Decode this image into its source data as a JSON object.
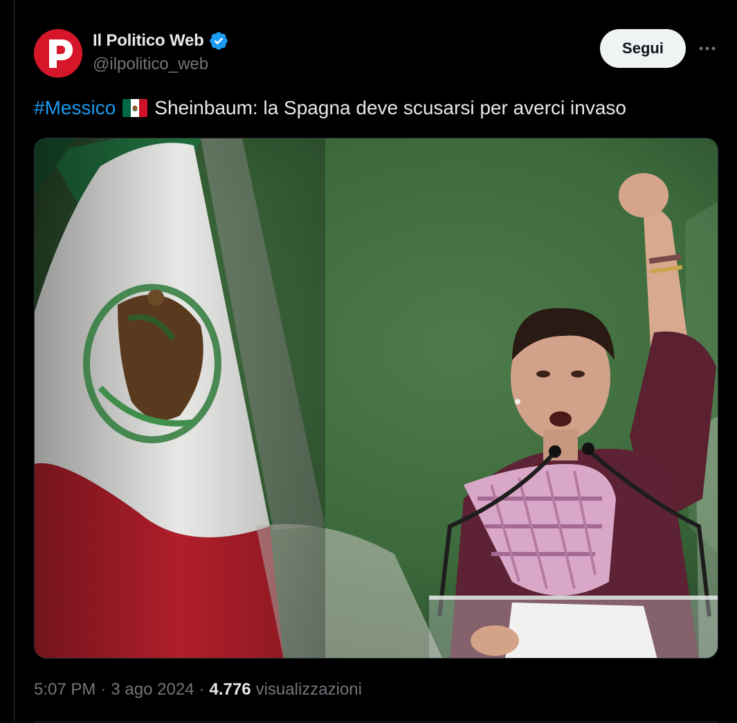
{
  "author": {
    "display_name": "Il Politico Web",
    "handle": "@ilpolitico_web",
    "avatar_letter": "P",
    "avatar_color": "#d6172a",
    "verified": true,
    "verified_icon": "verified-badge-icon",
    "verified_color": "#1d9bf0"
  },
  "actions": {
    "follow_label": "Segui",
    "more_icon": "more-horizontal-icon"
  },
  "tweet": {
    "hashtag": "#Messico",
    "flag_icon": "mexico-flag-icon",
    "text": "Sheinbaum: la Spagna deve scusarsi per averci invaso",
    "media_icon": "photo-woman-speaking-podium-mexican-flag"
  },
  "meta": {
    "time": "5:07 PM",
    "date": "3 ago 2024",
    "views_count": "4.776",
    "views_label": "visualizzazioni",
    "separator": "·"
  },
  "colors": {
    "background": "#000000",
    "text_primary": "#e7e9ea",
    "text_secondary": "#71767b",
    "link": "#1d9bf0",
    "button_bg": "#eff3f4",
    "border": "#2f3336"
  }
}
